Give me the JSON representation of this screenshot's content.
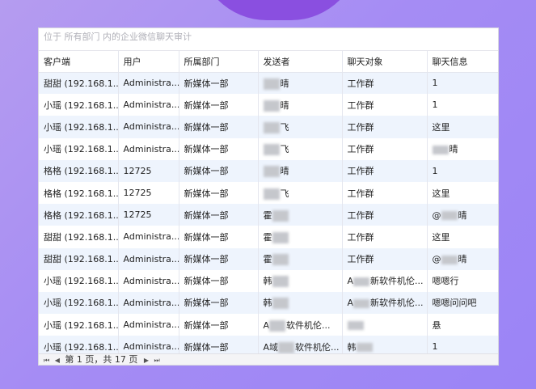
{
  "caption": "位于 所有部门 内的企业微信聊天审计",
  "columns": [
    "客户端",
    "用户",
    "所属部门",
    "发送者",
    "聊天对象",
    "聊天信息"
  ],
  "rows": [
    {
      "client": "甜甜 (192.168.1...",
      "user": "Administra...",
      "dept": "新媒体一部",
      "sender_pre": "",
      "sender_post": "晴",
      "target_pre": "",
      "target_post": "工作群",
      "msg_pre": "",
      "msg_post": "1"
    },
    {
      "client": "小瑶 (192.168.1...",
      "user": "Administra...",
      "dept": "新媒体一部",
      "sender_pre": "",
      "sender_post": "晴",
      "target_pre": "",
      "target_post": "工作群",
      "msg_pre": "",
      "msg_post": "1"
    },
    {
      "client": "小瑶 (192.168.1...",
      "user": "Administra...",
      "dept": "新媒体一部",
      "sender_pre": "",
      "sender_post": "飞",
      "target_pre": "",
      "target_post": "工作群",
      "msg_pre": "",
      "msg_post": "这里"
    },
    {
      "client": "小瑶 (192.168.1...",
      "user": "Administra...",
      "dept": "新媒体一部",
      "sender_pre": "",
      "sender_post": "飞",
      "target_pre": "",
      "target_post": "工作群",
      "msg_pre": "",
      "msg_post": "晴"
    },
    {
      "client": "格格 (192.168.1...",
      "user": "12725",
      "dept": "新媒体一部",
      "sender_pre": "",
      "sender_post": "晴",
      "target_pre": "",
      "target_post": "工作群",
      "msg_pre": "",
      "msg_post": "1"
    },
    {
      "client": "格格 (192.168.1...",
      "user": "12725",
      "dept": "新媒体一部",
      "sender_pre": "",
      "sender_post": "飞",
      "target_pre": "",
      "target_post": "工作群",
      "msg_pre": "",
      "msg_post": "这里"
    },
    {
      "client": "格格 (192.168.1...",
      "user": "12725",
      "dept": "新媒体一部",
      "sender_pre": "霍",
      "sender_post": "",
      "target_pre": "",
      "target_post": "工作群",
      "msg_pre": "@",
      "msg_post": "晴"
    },
    {
      "client": "甜甜 (192.168.1...",
      "user": "Administra...",
      "dept": "新媒体一部",
      "sender_pre": "霍",
      "sender_post": "",
      "target_pre": "",
      "target_post": "工作群",
      "msg_pre": "",
      "msg_post": "这里"
    },
    {
      "client": "甜甜 (192.168.1...",
      "user": "Administra...",
      "dept": "新媒体一部",
      "sender_pre": "霍",
      "sender_post": "",
      "target_pre": "",
      "target_post": "工作群",
      "msg_pre": "@",
      "msg_post": "晴"
    },
    {
      "client": "小瑶 (192.168.1...",
      "user": "Administra...",
      "dept": "新媒体一部",
      "sender_pre": "韩",
      "sender_post": "",
      "target_pre": "A",
      "target_post": "新软件机伦...",
      "msg_pre": "",
      "msg_post": "嗯嗯行"
    },
    {
      "client": "小瑶 (192.168.1...",
      "user": "Administra...",
      "dept": "新媒体一部",
      "sender_pre": "韩",
      "sender_post": "",
      "target_pre": "A",
      "target_post": "新软件机伦...",
      "msg_pre": "",
      "msg_post": "嗯嗯问问吧"
    },
    {
      "client": "小瑶 (192.168.1...",
      "user": "Administra...",
      "dept": "新媒体一部",
      "sender_pre": "A",
      "sender_post": "软件机伦...",
      "target_pre": "",
      "target_post": "",
      "msg_pre": "",
      "msg_post": "悬"
    },
    {
      "client": "小瑶 (192.168.1...",
      "user": "Administra...",
      "dept": "新媒体一部",
      "sender_pre": "A域",
      "sender_post": "软件机伦...",
      "target_pre": "韩",
      "target_post": "",
      "msg_pre": "",
      "msg_post": "1"
    }
  ],
  "pager": {
    "first": "⏮",
    "prev": "◀",
    "label": "第 1 页，共 17 页",
    "next": "▶",
    "last": "⏭"
  }
}
